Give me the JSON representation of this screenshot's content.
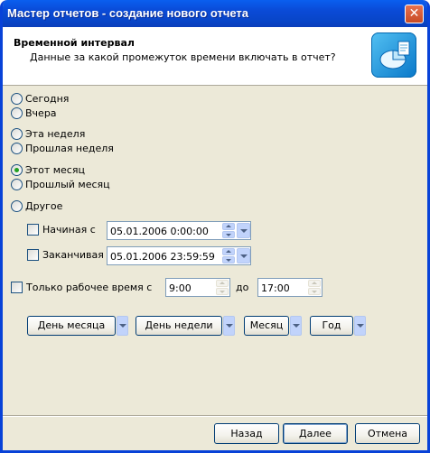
{
  "window": {
    "title": "Мастер отчетов - создание нового отчета",
    "close_glyph": "✕"
  },
  "header": {
    "title": "Временной интервал",
    "subtitle": "Данные за какой промежуток времени включать в отчет?",
    "icon": "wizard-report-icon"
  },
  "periods": {
    "today": "Сегодня",
    "yesterday": "Вчера",
    "this_week": "Эта неделя",
    "last_week": "Прошлая неделя",
    "this_month": "Этот месяц",
    "last_month": "Прошлый месяц",
    "other": "Другое",
    "selected": "this_month"
  },
  "range": {
    "start_label": "Начиная с",
    "start_value": "05.01.2006 0:00:00",
    "end_label": "Заканчивая",
    "end_value": "05.01.2006 23:59:59"
  },
  "work_time": {
    "label": "Только рабочее время с",
    "from": "9:00",
    "to_label": "до",
    "to": "17:00"
  },
  "grouping": {
    "day_of_month": "День месяца",
    "day_of_week": "День недели",
    "month": "Месяц",
    "year": "Год"
  },
  "footer": {
    "back": "Назад",
    "next": "Далее",
    "cancel": "Отмена"
  }
}
